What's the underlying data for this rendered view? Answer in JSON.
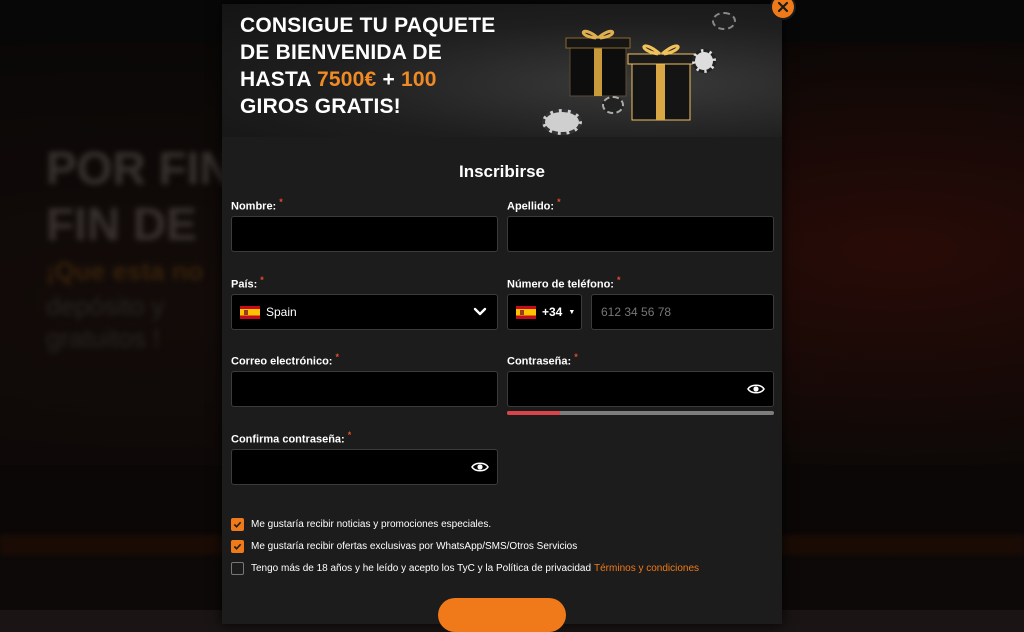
{
  "banner": {
    "line1": "CONSIGUE TU PAQUETE",
    "line2": "DE BIENVENIDA DE",
    "line3_pre": "HASTA ",
    "line3_amount": "7500€",
    "line3_mid": " + ",
    "line3_spins": "100",
    "line4": "GIROS GRATIS!"
  },
  "form": {
    "title": "Inscribirse",
    "first_name_label": "Nombre:",
    "last_name_label": "Apellido:",
    "country_label": "País:",
    "country_value": "Spain",
    "phone_label": "Número de teléfono:",
    "phone_code": "+34",
    "phone_placeholder": "612 34 56 78",
    "email_label": "Correo electrónico:",
    "password_label": "Contraseña:",
    "confirm_password_label": "Confirma contraseña:",
    "required_mark": "*",
    "password_strength": 0.2
  },
  "checkboxes": [
    {
      "text": "Me gustaría recibir noticias y promociones especiales.",
      "checked": true
    },
    {
      "text": "Me gustaría recibir ofertas exclusivas por WhatsApp/SMS/Otros Servicios",
      "checked": true
    },
    {
      "text": "Tengo más de 18 años y he leído y acepto los TyC y la Política de privacidad",
      "checked": false,
      "link": "Términos y condiciones"
    }
  ],
  "colors": {
    "accent": "#f07a1a",
    "field_bg": "#000000",
    "modal_bg": "#1c1c1c",
    "strength_weak": "#d9434a"
  }
}
